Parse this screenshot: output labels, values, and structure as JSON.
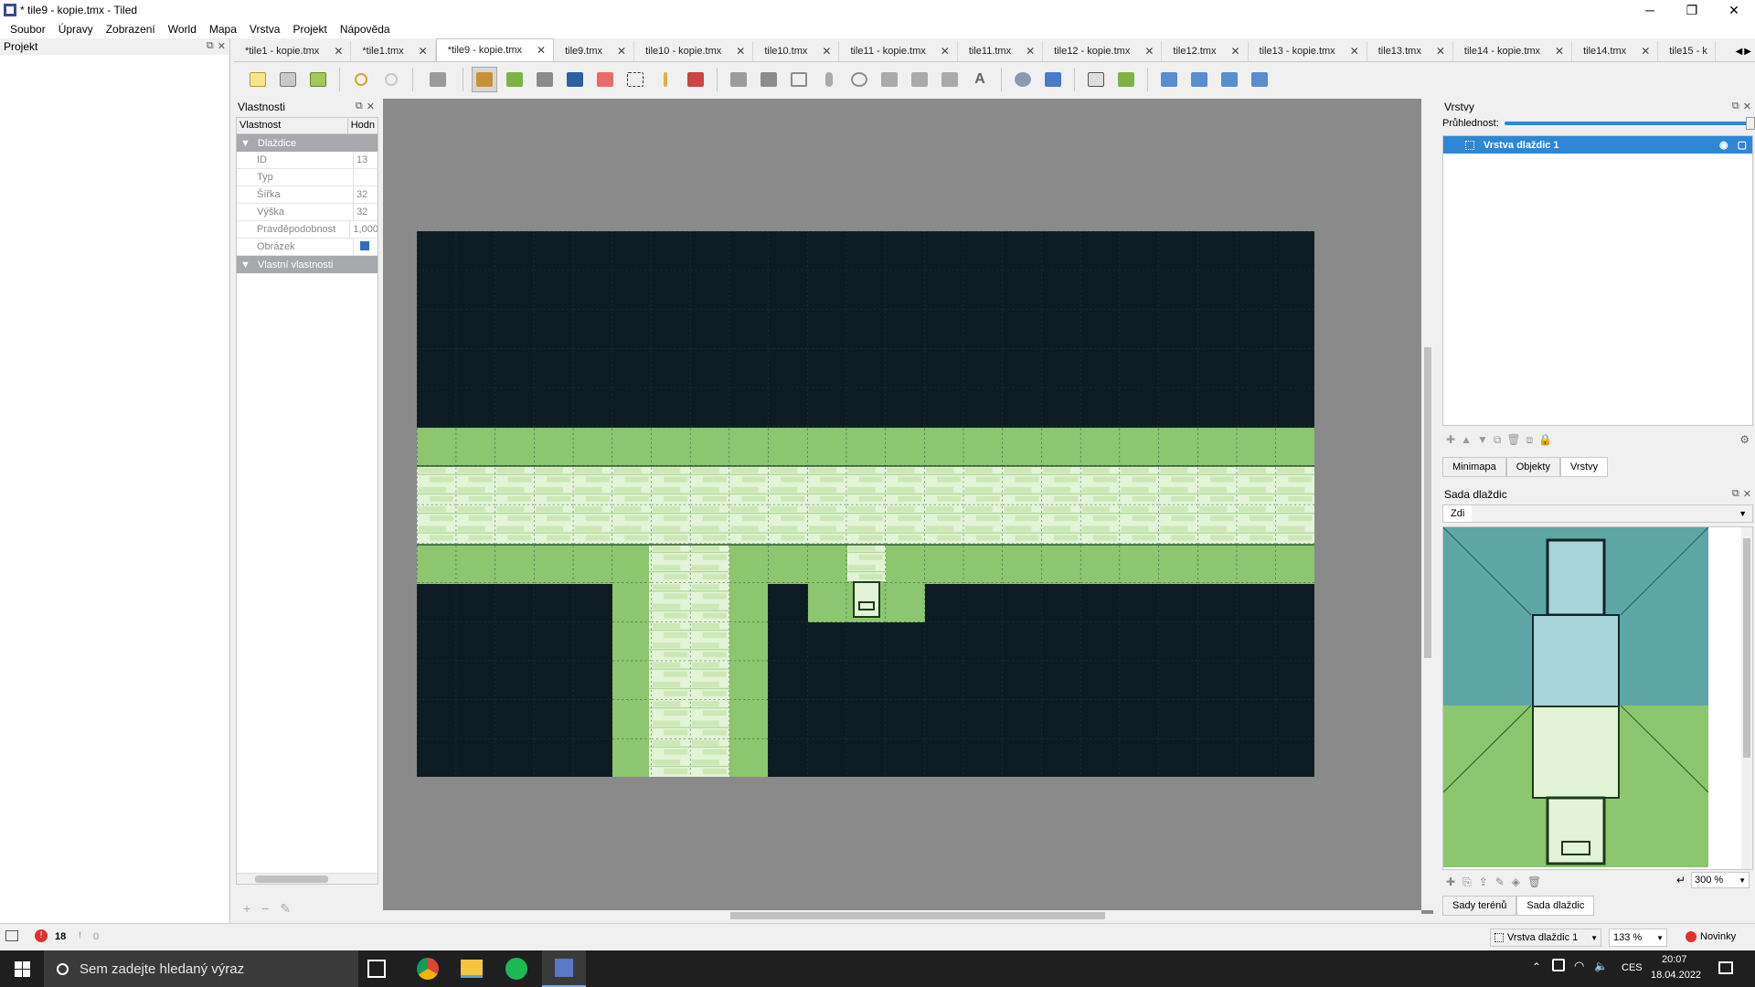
{
  "window": {
    "title": "* tile9 - kopie.tmx - Tiled",
    "minimize": "─",
    "maximize": "❐",
    "close": "✕"
  },
  "menu": [
    "Soubor",
    "Úpravy",
    "Zobrazení",
    "World",
    "Mapa",
    "Vrstva",
    "Projekt",
    "Nápověda"
  ],
  "projekt_panel": {
    "title": "Projekt"
  },
  "tabs": [
    {
      "label": "*tile1 - kopie.tmx",
      "active": false
    },
    {
      "label": "*tile1.tmx",
      "active": false
    },
    {
      "label": "*tile9 - kopie.tmx",
      "active": true
    },
    {
      "label": "tile9.tmx",
      "active": false
    },
    {
      "label": "tile10 - kopie.tmx",
      "active": false
    },
    {
      "label": "tile10.tmx",
      "active": false
    },
    {
      "label": "tile11 - kopie.tmx",
      "active": false
    },
    {
      "label": "tile11.tmx",
      "active": false
    },
    {
      "label": "tile12 - kopie.tmx",
      "active": false
    },
    {
      "label": "tile12.tmx",
      "active": false
    },
    {
      "label": "tile13 - kopie.tmx",
      "active": false
    },
    {
      "label": "tile13.tmx",
      "active": false
    },
    {
      "label": "tile14 - kopie.tmx",
      "active": false
    },
    {
      "label": "tile14.tmx",
      "active": false
    },
    {
      "label": "tile15 - k",
      "active": false
    }
  ],
  "properties": {
    "title": "Vlastnosti",
    "col_property": "Vlastnost",
    "col_value": "Hodn",
    "group_tile": "Dlaždice",
    "rows": [
      {
        "key": "ID",
        "value": "13"
      },
      {
        "key": "Typ",
        "value": ""
      },
      {
        "key": "Šířka",
        "value": "32"
      },
      {
        "key": "Výška",
        "value": "32"
      },
      {
        "key": "Pravděpodobnost",
        "value": "1,000"
      },
      {
        "key": "Obrázek",
        "value": ""
      }
    ],
    "group_custom": "Vlastní vlastnosti"
  },
  "layers_panel": {
    "title": "Vrstvy",
    "opacity_label": "Průhlednost:",
    "opacity": 1.0,
    "layer_name": "Vrstva dlaždic 1",
    "tabs": [
      "Minimapa",
      "Objekty",
      "Vrstvy"
    ],
    "active_tab": "Vrstvy"
  },
  "tileset_panel": {
    "title": "Sada dlaždic",
    "tileset_name": "Zdi",
    "zoom": "300 %",
    "tabs": [
      "Sady terénů",
      "Sada dlaždic"
    ],
    "active_tab": "Sada dlaždic"
  },
  "statusbar": {
    "errors": "18",
    "warnings": "0",
    "layer_select": "Vrstva dlaždic 1",
    "zoom": "133 %",
    "news": "Novinky"
  },
  "taskbar": {
    "search_placeholder": "Sem zadejte hledaný výraz",
    "time": "20:07",
    "date": "18.04.2022",
    "lang": "CES"
  },
  "colors": {
    "map_bg": "#0c1c22",
    "grass": "#8cc66e",
    "brick": "#dff2d2",
    "selection": "#2e86d4",
    "canvas_bg": "#8a8a8a"
  }
}
